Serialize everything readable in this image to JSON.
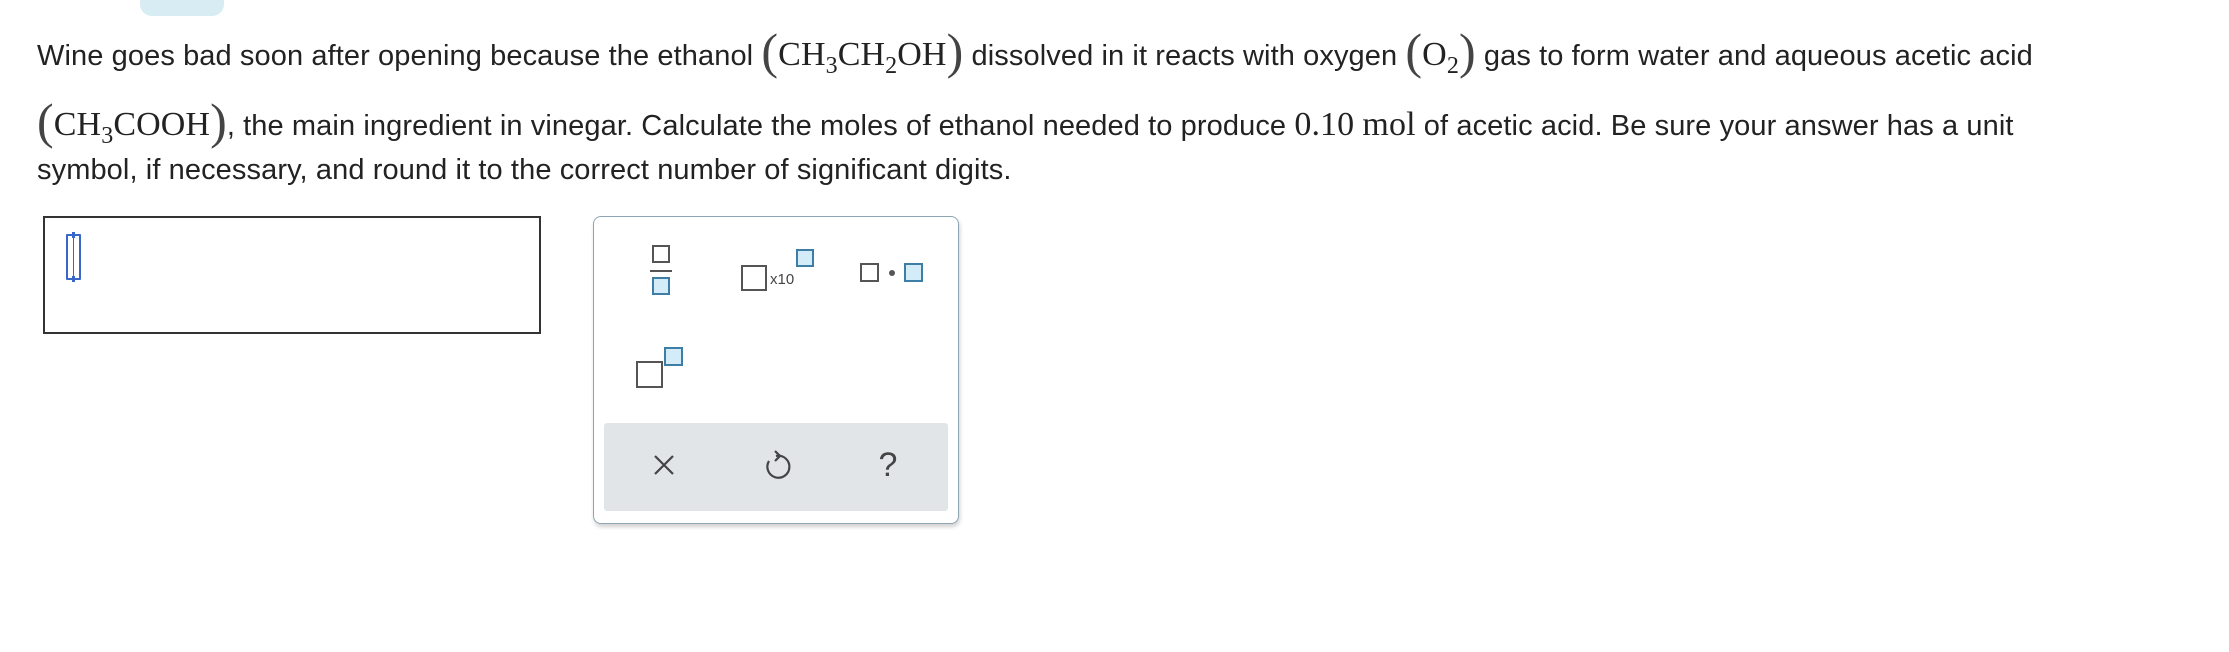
{
  "question": {
    "p1": "Wine goes bad soon after opening because the ethanol",
    "ethanol_formula": [
      "CH",
      "3",
      "CH",
      "2",
      "OH"
    ],
    "p2": "dissolved in it reacts with oxygen",
    "oxygen_formula": [
      "O",
      "2"
    ],
    "p3": "gas to form water and aqueous acetic acid",
    "acetic_formula": [
      "CH",
      "3",
      "COOH"
    ],
    "p4": ", the main ingredient in vinegar. Calculate the moles of ethanol needed to produce",
    "quantity": "0.10",
    "unit": "mol",
    "p5": "of acetic acid. Be sure your answer has a unit",
    "p6": "symbol, if necessary, and round it to the correct number of significant digits."
  },
  "answer": {
    "value": ""
  },
  "palette": {
    "x10_label": "x10",
    "tools": [
      "fraction-icon",
      "scientific-notation-icon",
      "multiplication-dot-icon",
      "superscript-icon"
    ],
    "actions": [
      "clear-icon",
      "undo-icon",
      "help-icon"
    ],
    "help_glyph": "?"
  },
  "colors": {
    "accent": "#3d7ea6",
    "accent_fill": "#d3ecf7",
    "cursor": "#3866c9",
    "palette_border": "#8ea6b4",
    "action_bar": "#e1e5e7"
  }
}
